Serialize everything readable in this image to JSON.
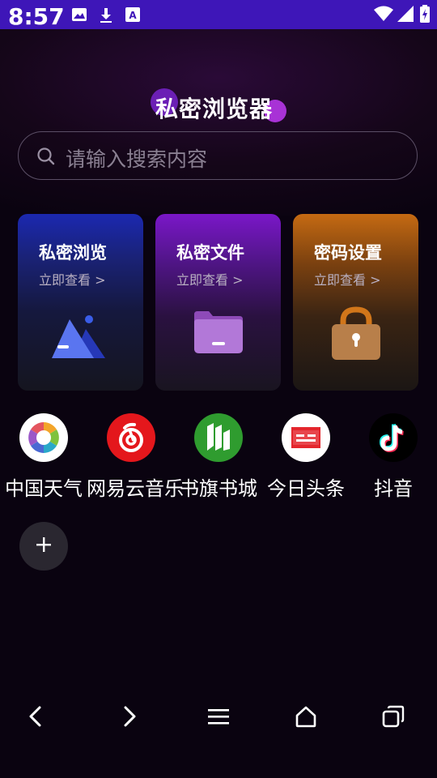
{
  "status_bar": {
    "time": "8:57",
    "icons": [
      "photo-icon",
      "download-icon",
      "font-icon",
      "wifi-icon",
      "signal-icon",
      "battery-charging-icon"
    ]
  },
  "app": {
    "title": "私密浏览器",
    "accent_purple": "#a832d6",
    "status_bar_color": "#3e16b8"
  },
  "search": {
    "placeholder": "请输入搜索内容"
  },
  "cards": [
    {
      "title": "私密浏览",
      "link": "立即查看 >",
      "icon": "mountain-image-icon",
      "color": "#1b28b0"
    },
    {
      "title": "私密文件",
      "link": "立即查看 >",
      "icon": "folder-icon",
      "color": "#7a17c8"
    },
    {
      "title": "密码设置",
      "link": "立即查看 >",
      "icon": "padlock-icon",
      "color": "#c56a12"
    }
  ],
  "shortcuts": [
    {
      "label": "中国天气",
      "icon": "weather-pinwheel-icon"
    },
    {
      "label": "网易云音乐",
      "icon": "netease-music-icon"
    },
    {
      "label": "书旗书城",
      "icon": "bookstore-icon"
    },
    {
      "label": "今日头条",
      "icon": "toutiao-icon"
    },
    {
      "label": "抖音",
      "icon": "douyin-icon"
    }
  ],
  "add_shortcut": {
    "icon": "plus-icon"
  },
  "nav": {
    "items": [
      "back-icon",
      "forward-icon",
      "menu-icon",
      "home-icon",
      "tabs-icon"
    ]
  }
}
